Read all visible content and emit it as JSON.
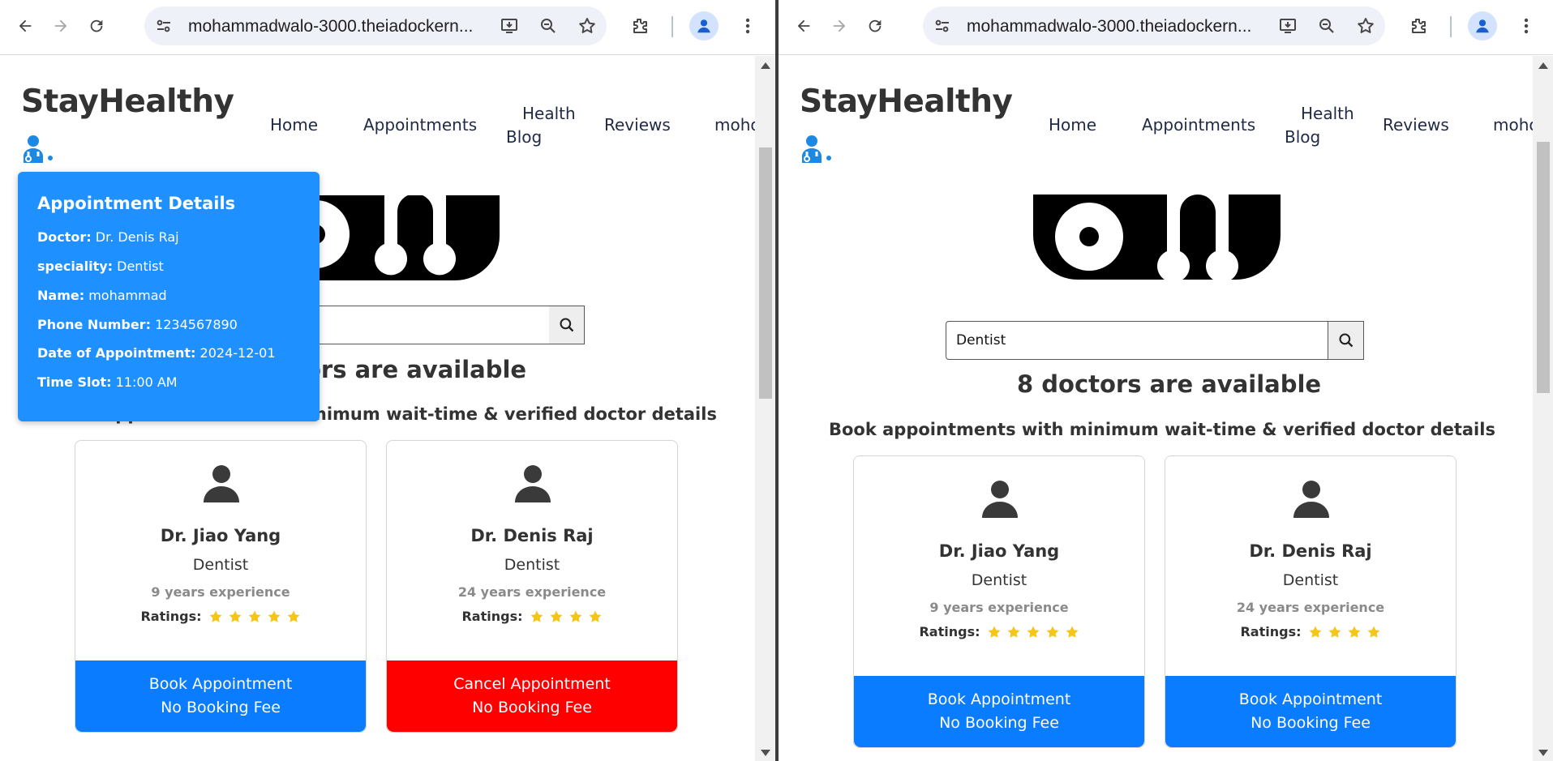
{
  "browser": {
    "url": "mohammadwalo-3000.theiadockern..."
  },
  "site": {
    "brand": "StayHealthy",
    "nav": {
      "home": "Home",
      "appointments": "Appointments",
      "health_blog_line1": "Health",
      "health_blog_line2": "Blog",
      "reviews": "Reviews",
      "user_partial": "moho"
    },
    "subtitle": "Book appointments with minimum wait-time & verified doctor details",
    "ratings_label": "Ratings:",
    "book_label": "Book Appointment",
    "cancel_label": "Cancel Appointment",
    "fee_label": "No Booking Fee"
  },
  "left_window": {
    "search_value": "",
    "count_title_partial": "ors are available",
    "doctors": [
      {
        "name": "Dr. Jiao Yang",
        "speciality": "Dentist",
        "experience": "9 years experience",
        "stars": 5,
        "action": "book"
      },
      {
        "name": "Dr. Denis Raj",
        "speciality": "Dentist",
        "experience": "24 years experience",
        "stars": 4,
        "action": "cancel"
      }
    ],
    "appointment_popup": {
      "title": "Appointment Details",
      "rows": [
        {
          "label": "Doctor:",
          "value": "Dr. Denis Raj"
        },
        {
          "label": "speciality:",
          "value": "Dentist"
        },
        {
          "label": "Name:",
          "value": "mohammad"
        },
        {
          "label": "Phone Number:",
          "value": "1234567890"
        },
        {
          "label": "Date of Appointment:",
          "value": "2024-12-01"
        },
        {
          "label": "Time Slot:",
          "value": "11:00 AM"
        }
      ]
    }
  },
  "right_window": {
    "search_value": "Dentist",
    "count_title": "8 doctors are available",
    "doctors": [
      {
        "name": "Dr. Jiao Yang",
        "speciality": "Dentist",
        "experience": "9 years experience",
        "stars": 5,
        "action": "book"
      },
      {
        "name": "Dr. Denis Raj",
        "speciality": "Dentist",
        "experience": "24 years experience",
        "stars": 4,
        "action": "book"
      }
    ]
  },
  "icons": {
    "back": "back-arrow-icon",
    "forward": "forward-arrow-icon",
    "reload": "reload-icon",
    "site_info": "tune-icon",
    "install": "install-app-icon",
    "zoom": "zoom-icon",
    "bookmark": "star-bookmark-icon",
    "extensions": "puzzle-icon",
    "profile": "profile-icon",
    "menu": "kebab-menu-icon",
    "brand_logo": "doctor-logo-icon",
    "search": "search-icon",
    "doctor_avatar": "person-icon",
    "rating_star": "star-icon"
  },
  "colors": {
    "book": "#0a7cff",
    "cancel": "#ff0000",
    "popup": "#1e90ff",
    "star": "#f5c518"
  }
}
